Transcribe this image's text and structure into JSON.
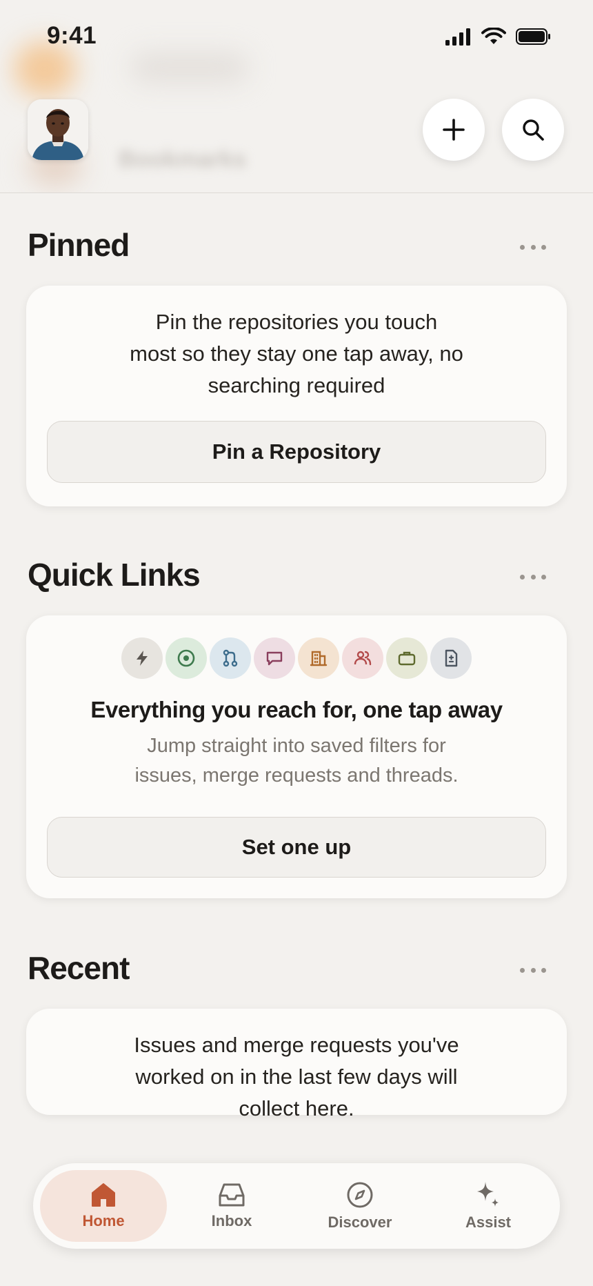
{
  "status_bar": {
    "time": "9:41"
  },
  "header": {
    "blurred_title": "Bookmarks"
  },
  "pinned": {
    "title": "Pinned",
    "description": "Pin the repositories you touch most so they stay one tap away, no searching required",
    "button_label": "Pin a Repository"
  },
  "quick_links": {
    "title": "Quick Links",
    "icons": [
      {
        "name": "bolt-icon",
        "color": "#5a5550",
        "bg": "#e7e4df"
      },
      {
        "name": "target-icon",
        "color": "#3e7a4d",
        "bg": "#dcebdc"
      },
      {
        "name": "merge-request-icon",
        "color": "#3d6d8c",
        "bg": "#dce7ee"
      },
      {
        "name": "chat-icon",
        "color": "#8a3f5d",
        "bg": "#eedde3"
      },
      {
        "name": "building-icon",
        "color": "#b06a2a",
        "bg": "#f4e3d1"
      },
      {
        "name": "people-icon",
        "color": "#b24a4a",
        "bg": "#f3dede"
      },
      {
        "name": "briefcase-icon",
        "color": "#5e6a2e",
        "bg": "#e6e8d6"
      },
      {
        "name": "document-icon",
        "color": "#4c5560",
        "bg": "#e1e3e6"
      }
    ],
    "heading": "Everything you reach for, one tap away",
    "subtext": "Jump straight into saved filters for issues, merge requests and threads.",
    "button_label": "Set one up"
  },
  "recent": {
    "title": "Recent",
    "description": "Issues and merge requests you've worked on in the last few days will collect here."
  },
  "tab_bar": {
    "tabs": [
      {
        "label": "Home",
        "active": true
      },
      {
        "label": "Inbox",
        "active": false
      },
      {
        "label": "Discover",
        "active": false
      },
      {
        "label": "Assist",
        "active": false
      }
    ]
  },
  "colors": {
    "accent": "#c05734",
    "background": "#f3f1ee",
    "card": "#fcfbf9"
  }
}
